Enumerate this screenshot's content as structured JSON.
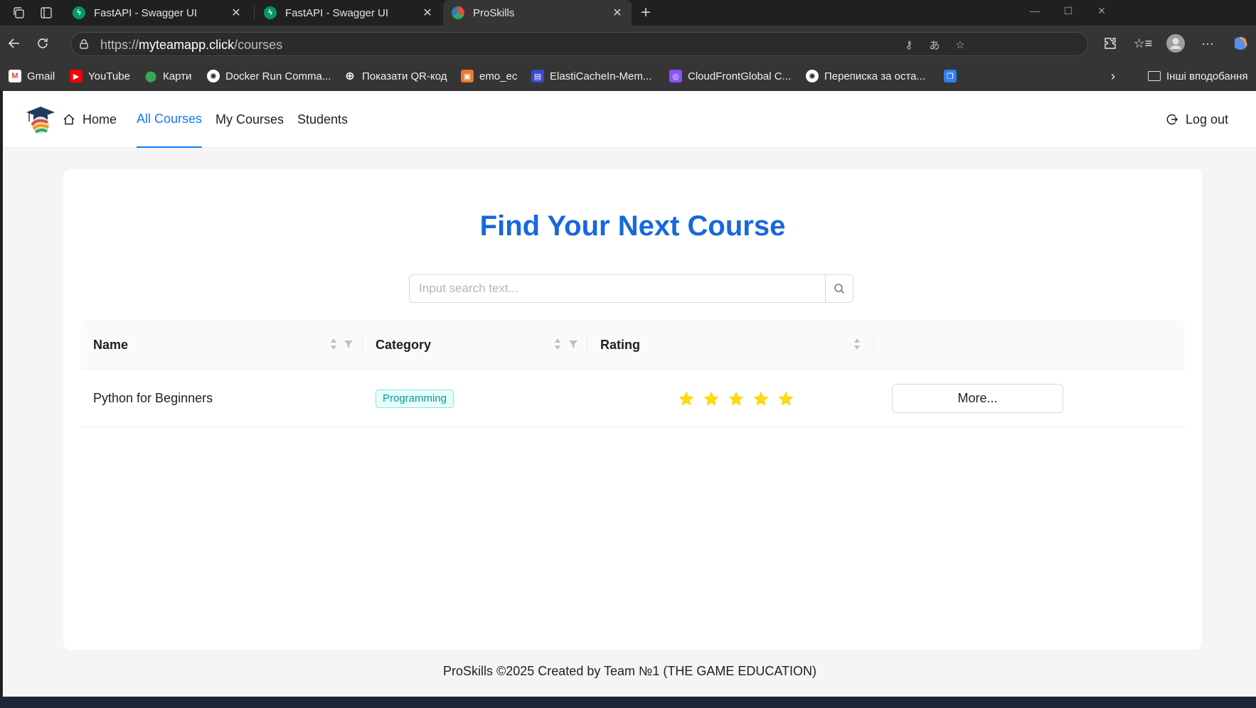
{
  "browser": {
    "tabs": [
      {
        "title": "FastAPI - Swagger UI",
        "favicon": "fastapi-icon",
        "active": false
      },
      {
        "title": "FastAPI - Swagger UI",
        "favicon": "fastapi-icon",
        "active": false
      },
      {
        "title": "ProSkills",
        "favicon": "proskills-logo-icon",
        "active": true
      }
    ],
    "url_scheme": "https://",
    "url_host": "myteamapp.click",
    "url_path": "/courses",
    "bookmarks": [
      {
        "label": "Gmail",
        "icon": "gmail-icon"
      },
      {
        "label": "YouTube",
        "icon": "youtube-icon"
      },
      {
        "label": "Карти",
        "icon": "maps-icon"
      },
      {
        "label": "Docker Run Comma...",
        "icon": "openai-icon"
      },
      {
        "label": "Показати QR-код",
        "icon": "globe-icon"
      },
      {
        "label": "emo_ec",
        "icon": "aws-icon"
      },
      {
        "label": "ElastiCacheIn-Mem...",
        "icon": "elasticache-icon"
      },
      {
        "label": "CloudFrontGlobal C...",
        "icon": "cloudfront-icon"
      },
      {
        "label": "Переписка за оста...",
        "icon": "openai-icon"
      }
    ],
    "other_bookmarks": "Інші вподобання"
  },
  "app": {
    "menu": {
      "home": "Home",
      "all_courses": "All Courses",
      "my_courses": "My Courses",
      "students": "Students",
      "logout": "Log out"
    },
    "active_menu": "All Courses",
    "headline": "Find Your Next Course",
    "search": {
      "placeholder": "Input search text...",
      "value": ""
    },
    "table": {
      "columns": [
        "Name",
        "Category",
        "Rating",
        ""
      ],
      "rows": [
        {
          "name": "Python for Beginners",
          "category": "Programming",
          "rating": 5,
          "action": "More..."
        }
      ]
    },
    "footer": "ProSkills ©2025 Created by Team №1 (THE GAME EDUCATION)",
    "colors": {
      "accent": "#1677ff",
      "headline": "#1668dc",
      "star": "#fadb14",
      "tag": "#08979c"
    }
  }
}
